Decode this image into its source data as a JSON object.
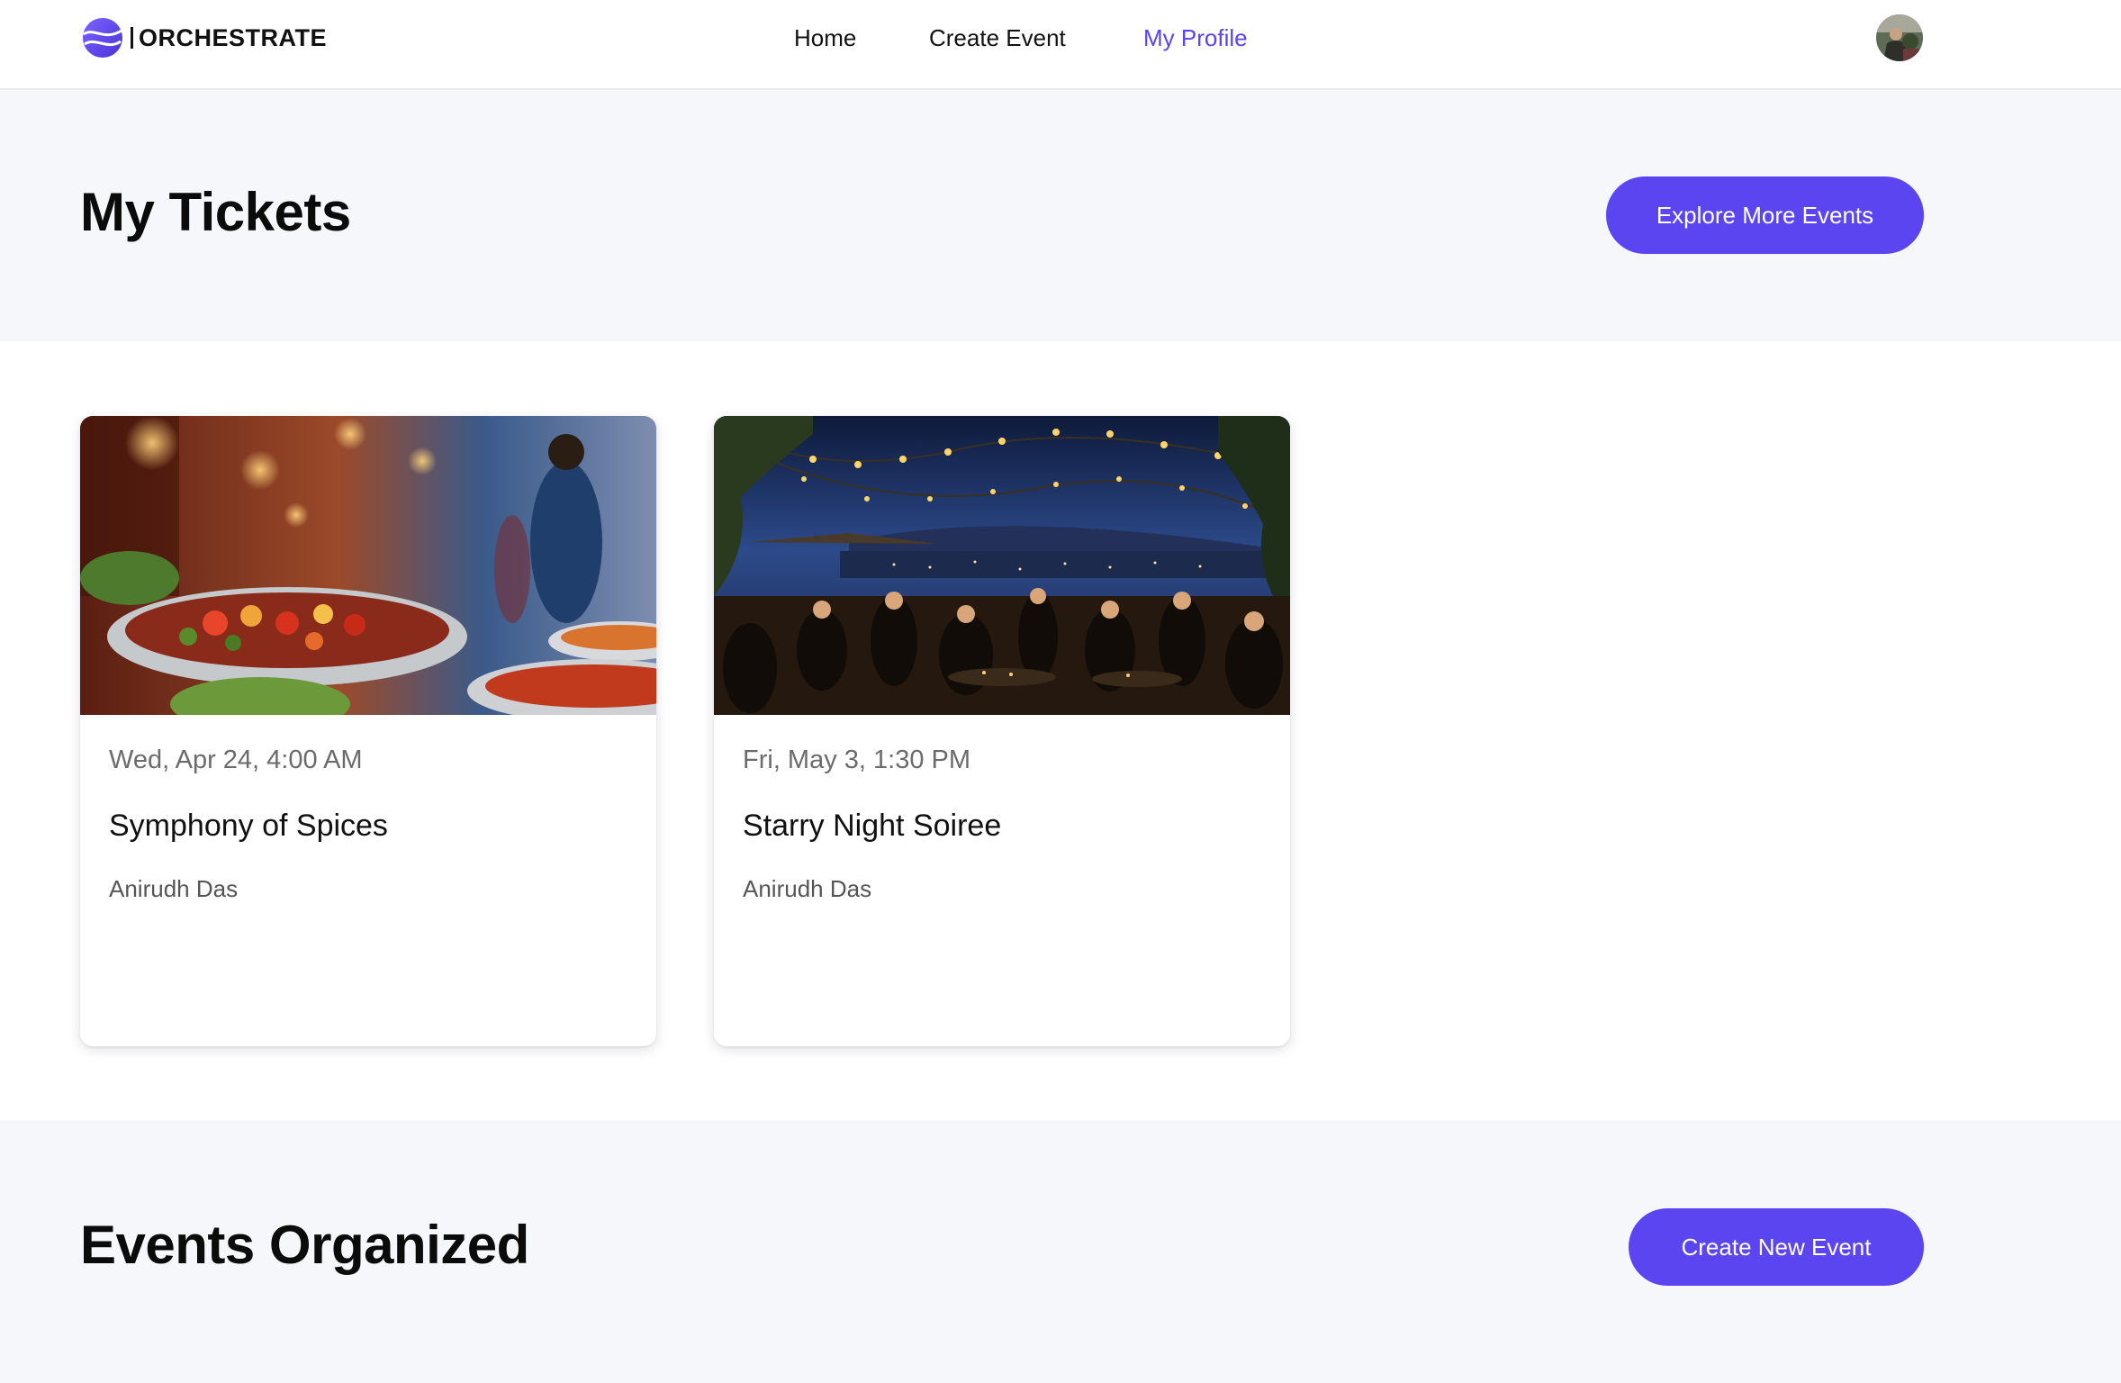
{
  "brand": {
    "name": "ORCHESTRATE",
    "accent": "#5b45f0"
  },
  "nav": {
    "home": "Home",
    "create_event": "Create Event",
    "my_profile": "My Profile"
  },
  "tickets_section": {
    "title": "My Tickets",
    "button": "Explore More Events",
    "cards": [
      {
        "date": "Wed, Apr 24, 4:00 AM",
        "title": "Symphony of Spices",
        "organizer": "Anirudh Das"
      },
      {
        "date": "Fri, May 3, 1:30 PM",
        "title": "Starry Night Soiree",
        "organizer": "Anirudh Das"
      }
    ]
  },
  "organized_section": {
    "title": "Events Organized",
    "button": "Create New Event"
  }
}
